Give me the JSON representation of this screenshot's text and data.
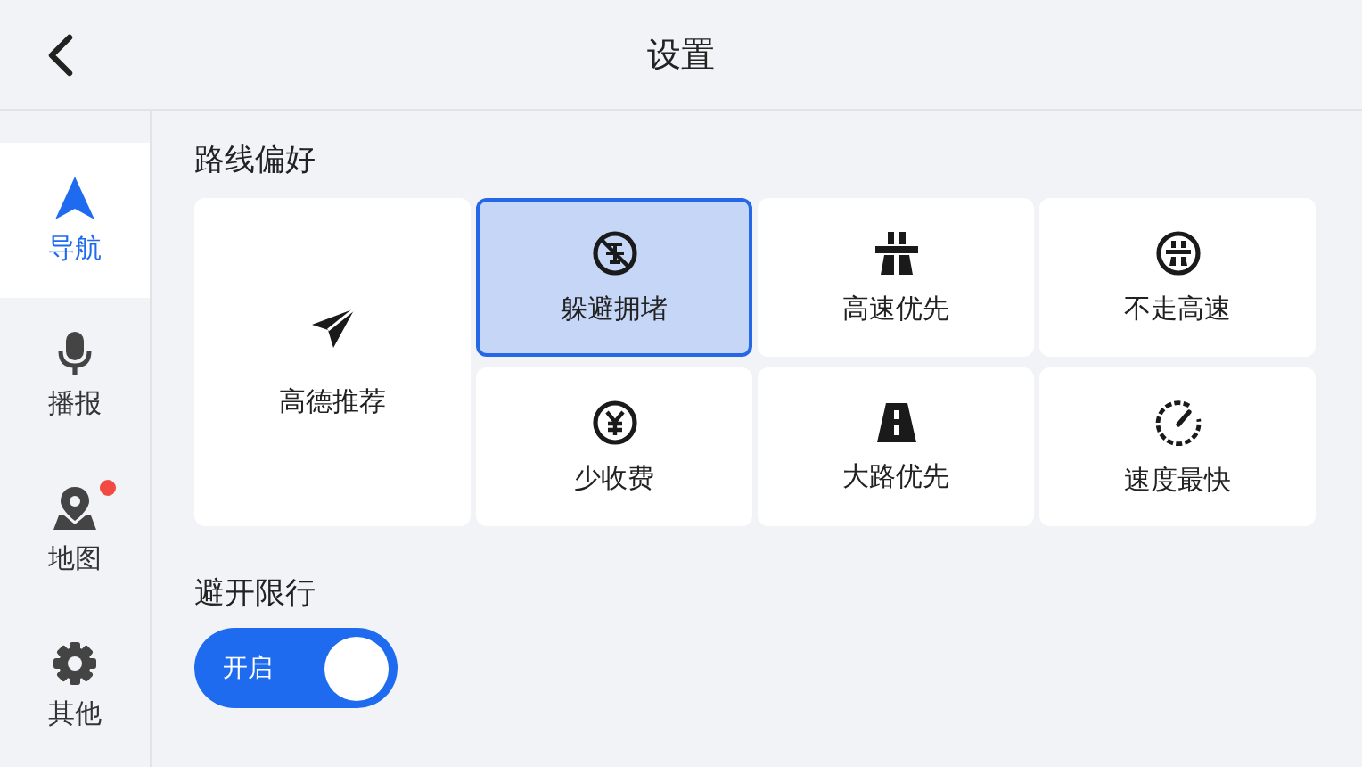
{
  "header": {
    "title": "设置"
  },
  "sidebar": {
    "items": [
      {
        "kind": "navigation",
        "label": "导航",
        "selected": true,
        "badge": false
      },
      {
        "kind": "voice",
        "label": "播报",
        "selected": false,
        "badge": false
      },
      {
        "kind": "map",
        "label": "地图",
        "selected": false,
        "badge": true
      },
      {
        "kind": "other",
        "label": "其他",
        "selected": false,
        "badge": false
      }
    ]
  },
  "route_preference": {
    "title": "路线偏好",
    "options": [
      {
        "kind": "recommend",
        "label": "高德推荐",
        "selected": false
      },
      {
        "kind": "avoid-jam",
        "label": "躲避拥堵",
        "selected": true
      },
      {
        "kind": "highway",
        "label": "高速优先",
        "selected": false
      },
      {
        "kind": "no-highway",
        "label": "不走高速",
        "selected": false
      },
      {
        "kind": "less-toll",
        "label": "少收费",
        "selected": false
      },
      {
        "kind": "main-road",
        "label": "大路优先",
        "selected": false
      },
      {
        "kind": "fastest",
        "label": "速度最快",
        "selected": false
      }
    ]
  },
  "restriction": {
    "title": "避开限行",
    "toggle": {
      "label": "开启",
      "on": true
    }
  }
}
